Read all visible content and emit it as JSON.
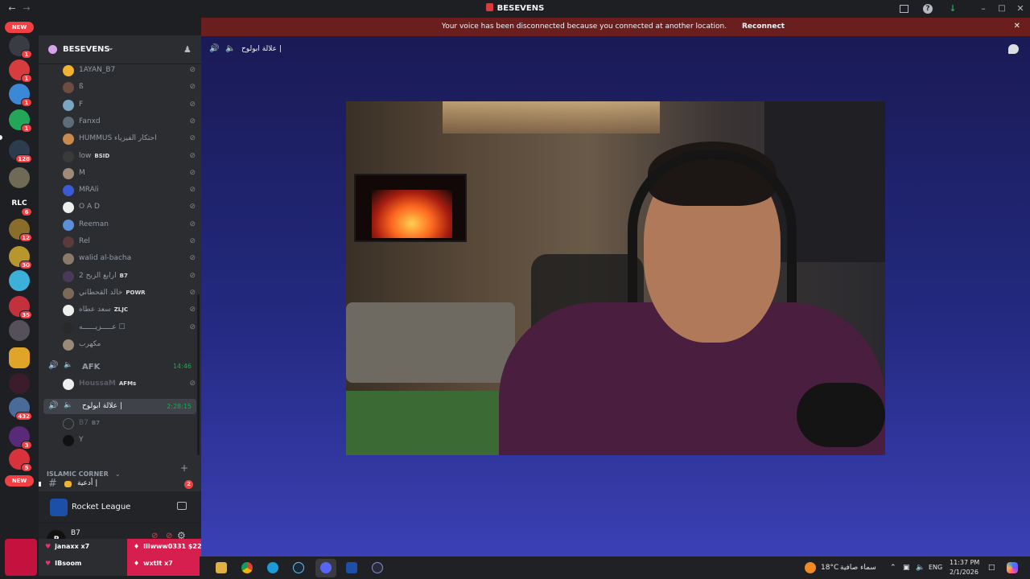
{
  "window": {
    "title": "BESEVENS"
  },
  "banner": {
    "message": "Your voice has been disconnected because you connected at another location.",
    "reconnect_label": "Reconnect"
  },
  "rail": {
    "new_top": "NEW",
    "new_bottom": "NEW",
    "badges": [
      "1",
      "1",
      "1",
      "1",
      "128",
      "6",
      "12",
      "30",
      "35",
      "432",
      "3",
      "5"
    ],
    "rlc_label": "RLC"
  },
  "server": {
    "name": "BESEVENS"
  },
  "members": [
    {
      "name": "1AYAN_B7",
      "tag": "",
      "color": "#f0b232"
    },
    {
      "name": "ß",
      "tag": "",
      "color": "#6d4c41"
    },
    {
      "name": "F",
      "tag": "",
      "color": "#7aa6c2"
    },
    {
      "name": "Fanxd",
      "tag": "",
      "color": "#5d6b7a"
    },
    {
      "name": "HUMMUS احتكار الفيزياء",
      "tag": "",
      "color": "#c98a4b"
    },
    {
      "name": "low",
      "tag": "BSID",
      "color": "#3a3a3a"
    },
    {
      "name": "M",
      "tag": "",
      "color": "#a08a7a"
    },
    {
      "name": "MRAli",
      "tag": "",
      "color": "#3b5bd6"
    },
    {
      "name": "O A D",
      "tag": "",
      "color": "#eeeeee"
    },
    {
      "name": "Reeman",
      "tag": "",
      "color": "#5b8fd9"
    },
    {
      "name": "Rel",
      "tag": "",
      "color": "#5a3a3a"
    },
    {
      "name": "walid al-bacha",
      "tag": "",
      "color": "#8a7a6a"
    },
    {
      "name": "ارابع الزبح 2",
      "tag": "B7",
      "color": "#4a3a5a"
    },
    {
      "name": "خالد القحطاني",
      "tag": "POWR",
      "color": "#7a6a5a"
    },
    {
      "name": "سعد عطاه",
      "tag": "ZLJC",
      "color": "#eeeeee"
    },
    {
      "name": "عـــــزيــــــه ☐",
      "tag": "",
      "color": "#2a2a2a"
    },
    {
      "name": "مكهرب",
      "tag": "",
      "color": "#9a8a7a"
    }
  ],
  "afk": {
    "name": "AFK",
    "time": "14:46",
    "member": "HoussaM",
    "member_tag": "AFMs"
  },
  "voice_channel": {
    "name": "علالة ابولوح |",
    "time": "2:28:15",
    "members": [
      {
        "name": "B7",
        "tag": "B7"
      },
      {
        "name": "Y",
        "tag": ""
      }
    ]
  },
  "category": {
    "name": "ISLAMIC CORNER"
  },
  "text_channel": {
    "name": "أدعية |",
    "badge": "2"
  },
  "activity": {
    "game": "Rocket League"
  },
  "user_panel": {
    "name": "B7",
    "initial": "P"
  },
  "donations": {
    "left": [
      "janaxx x7",
      "IBsoom"
    ],
    "right": [
      "Iiiwww0331 $22",
      "wxtIt x7"
    ]
  },
  "stage": {
    "channel_title": "علالة ابولوح |"
  },
  "taskbar": {
    "weather": "18°C",
    "weather_text": "سماء صافية",
    "lang": "ENG",
    "time": "11:37 PM",
    "date": "2/1/2026"
  }
}
